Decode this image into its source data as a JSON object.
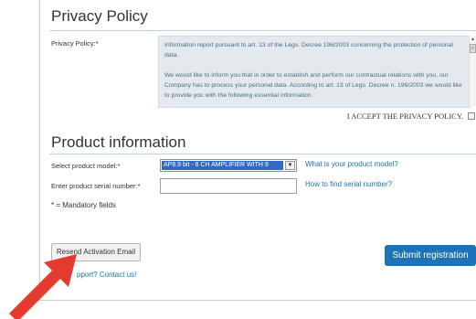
{
  "privacy": {
    "title": "Privacy Policy",
    "field_label": "Privacy Policy:*",
    "text_para1": "Information report pursuant to art. 13 of the Legs. Decree 196/2003 concerning the protection of personal data.",
    "text_para2": "We would like to inform you that in order to establish and perform our contractual relations with you, our Company has to process your personal data. According to art. 13 of Legs. Decree n. 196/2003 we would like to provide you with the following essential information.",
    "accept_label": "I ACCEPT THE PRIVACY POLICY."
  },
  "product": {
    "title": "Product information",
    "model_label": "Select product model:*",
    "model_value": "AP8.9 bit - 8 CH AMPLIFIER WITH 9",
    "model_help": "What is your product model?",
    "serial_label": "Enter product serial number:*",
    "serial_value": "",
    "serial_help": "How to find serial number?",
    "mandatory_note": "* = Mandatory fields"
  },
  "actions": {
    "resend_label": "Resend Activation Email",
    "submit_label": "Submit registration",
    "support_text": "pport? Contact us!"
  },
  "colors": {
    "link": "#1c74ad",
    "submit_bg": "#1d72b8",
    "arrow": "#e53b2f"
  }
}
